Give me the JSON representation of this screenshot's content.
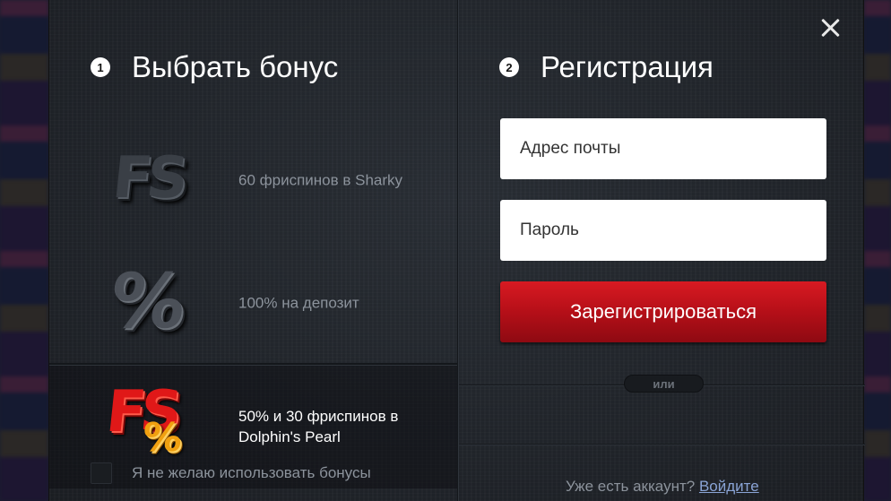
{
  "step1": {
    "number": "1",
    "title": "Выбрать бонус"
  },
  "step2": {
    "number": "2",
    "title": "Регистрация"
  },
  "bonuses": [
    {
      "label": "60 фриспинов в Sharky",
      "icon": "fs-icon",
      "icon_text": "FS",
      "selected": false
    },
    {
      "label": "100% на депозит",
      "icon": "percent-icon",
      "icon_text": "%",
      "selected": false
    },
    {
      "label": "50% и 30 фриспинов в Dolphin's Pearl",
      "icon": "fs-percent-icon",
      "icon_text_fs": "FS",
      "icon_text_pct": "%",
      "selected": true
    }
  ],
  "no_bonus": {
    "label": "Я не желаю использовать бонусы",
    "checked": false
  },
  "form": {
    "email_placeholder": "Адрес почты",
    "password_placeholder": "Пароль",
    "submit_label": "Зарегистрироваться",
    "or_label": "или"
  },
  "login": {
    "prompt": "Уже есть аккаунт?",
    "link_label": "Войдите"
  },
  "colors": {
    "accent_red": "#c8121b",
    "link_blue": "#8aa4d6",
    "muted_text": "#8c939c"
  }
}
